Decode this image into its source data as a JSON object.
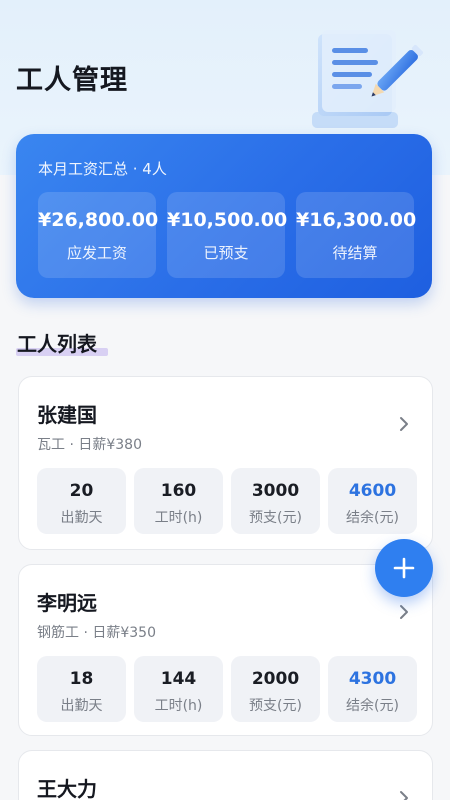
{
  "header": {
    "title": "工人管理",
    "illustration_icon": "document-pen-icon"
  },
  "summary": {
    "title": "本月工资汇总 · 4人",
    "stats": [
      {
        "value": "¥26,800.00",
        "label": "应发工资"
      },
      {
        "value": "¥10,500.00",
        "label": "已预支"
      },
      {
        "value": "¥16,300.00",
        "label": "待结算"
      }
    ],
    "accent_color": "#2a6ee8"
  },
  "list": {
    "title": "工人列表",
    "workers": [
      {
        "name": "张建国",
        "meta": "瓦工 · 日薪¥380",
        "stats": [
          {
            "value": "20",
            "label": "出勤天"
          },
          {
            "value": "160",
            "label": "工时(h)"
          },
          {
            "value": "3000",
            "label": "预支(元)"
          },
          {
            "value": "4600",
            "label": "结余(元)"
          }
        ]
      },
      {
        "name": "李明远",
        "meta": "钢筋工 · 日薪¥350",
        "stats": [
          {
            "value": "18",
            "label": "出勤天"
          },
          {
            "value": "144",
            "label": "工时(h)"
          },
          {
            "value": "2000",
            "label": "预支(元)"
          },
          {
            "value": "4300",
            "label": "结余(元)"
          }
        ]
      },
      {
        "name": "王大力"
      }
    ]
  },
  "fab": {
    "icon": "plus-icon",
    "color": "#2f7ff0"
  },
  "colors": {
    "balance_highlight": "#2d73e0"
  }
}
